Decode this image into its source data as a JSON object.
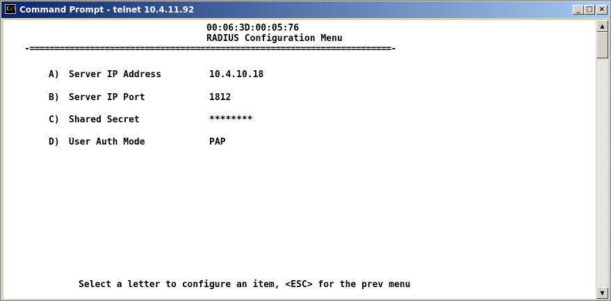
{
  "window": {
    "title": "Command Prompt - telnet 10.4.11.92",
    "icon": "cmd-icon",
    "controls": {
      "minimize": "_",
      "maximize": "□",
      "close": "×"
    }
  },
  "console": {
    "mac": "00:06:3D:00:05:76",
    "menu_title": "RADIUS Configuration Menu",
    "separator": "-========================================================================-",
    "items": [
      {
        "key": "A)",
        "label": "Server IP Address",
        "value": "10.4.10.18"
      },
      {
        "key": "B)",
        "label": "Server IP Port",
        "value": "1812"
      },
      {
        "key": "C)",
        "label": "Shared Secret",
        "value": "********"
      },
      {
        "key": "D)",
        "label": "User Auth Mode",
        "value": "PAP"
      }
    ],
    "prompt": "Select a letter to configure an item, <ESC> for the prev menu"
  },
  "scrollbar": {
    "up_arrow": "▲",
    "down_arrow": "▼"
  },
  "colors": {
    "titlebar_start": "#0a246a",
    "titlebar_end": "#a6caf0",
    "console_bg": "#ffffff",
    "console_fg": "#000000"
  }
}
